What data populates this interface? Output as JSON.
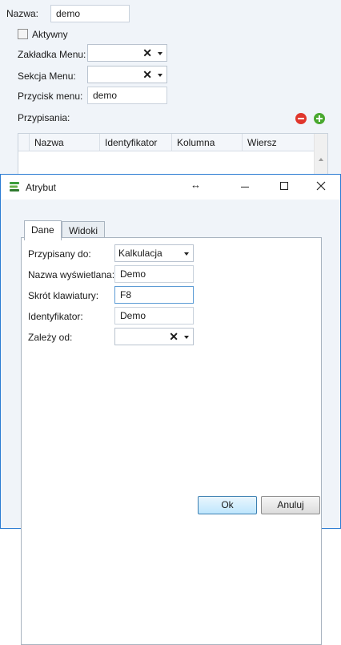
{
  "background_form": {
    "name_label": "Nazwa:",
    "name_value": "demo",
    "active_label": "Aktywny",
    "menu_tab_label": "Zakładka Menu:",
    "menu_section_label": "Sekcja Menu:",
    "menu_button_label": "Przycisk menu:",
    "menu_button_value": "demo",
    "assignments_label": "Przypisania:",
    "grid_columns": [
      "Nazwa wyświet",
      "Identyfikator",
      "Kolumna",
      "Wiersz"
    ],
    "remove_color": "#e0362c",
    "add_color": "#49a82f"
  },
  "dialog": {
    "title": "Atrybut",
    "tabs": [
      "Dane",
      "Widoki"
    ],
    "active_tab": "Dane",
    "fields": {
      "assigned_to_label": "Przypisany do:",
      "assigned_to_value": "Kalkulacja",
      "display_name_label": "Nazwa wyświetlana:",
      "display_name_value": "Demo",
      "shortcut_label": "Skrót klawiatury:",
      "shortcut_value": "F8",
      "identifier_label": "Identyfikator:",
      "identifier_value": "Demo",
      "depends_on_label": "Zależy od:"
    },
    "buttons": {
      "ok": "Ok",
      "cancel": "Anuluj"
    },
    "accent": "#2b7cd3"
  }
}
